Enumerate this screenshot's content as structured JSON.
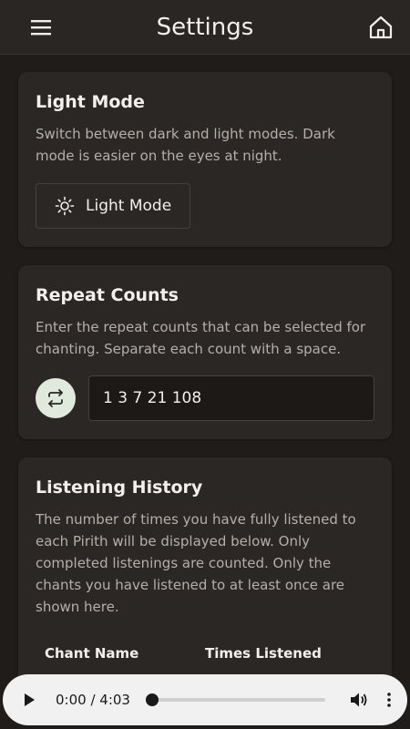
{
  "header": {
    "title": "Settings",
    "menu_icon": "hamburger-menu-icon",
    "home_icon": "home-icon"
  },
  "light_mode": {
    "title": "Light Mode",
    "description": "Switch between dark and light modes. Dark mode is easier on the eyes at night.",
    "button_label": "Light Mode",
    "button_icon": "sun-icon"
  },
  "repeat_counts": {
    "title": "Repeat Counts",
    "description": "Enter the repeat counts that can be selected for chanting. Separate each count with a space.",
    "value": "1 3 7 21 108",
    "icon": "repeat-icon"
  },
  "history": {
    "title": "Listening History",
    "description": "The number of times you have fully listened to each Pirith will be displayed below. Only completed listenings are counted. Only the chants you have listened to at least once are shown here.",
    "columns": [
      "Chant Name",
      "Times Listened"
    ]
  },
  "player": {
    "time": "0:00 / 4:03",
    "progress": 0,
    "play_icon": "play-icon",
    "volume_icon": "volume-icon",
    "more_icon": "more-vertical-icon"
  },
  "colors": {
    "background": "#1f1c1a",
    "card": "#2b2725",
    "accent_icon_bg": "#dfe9dc"
  }
}
